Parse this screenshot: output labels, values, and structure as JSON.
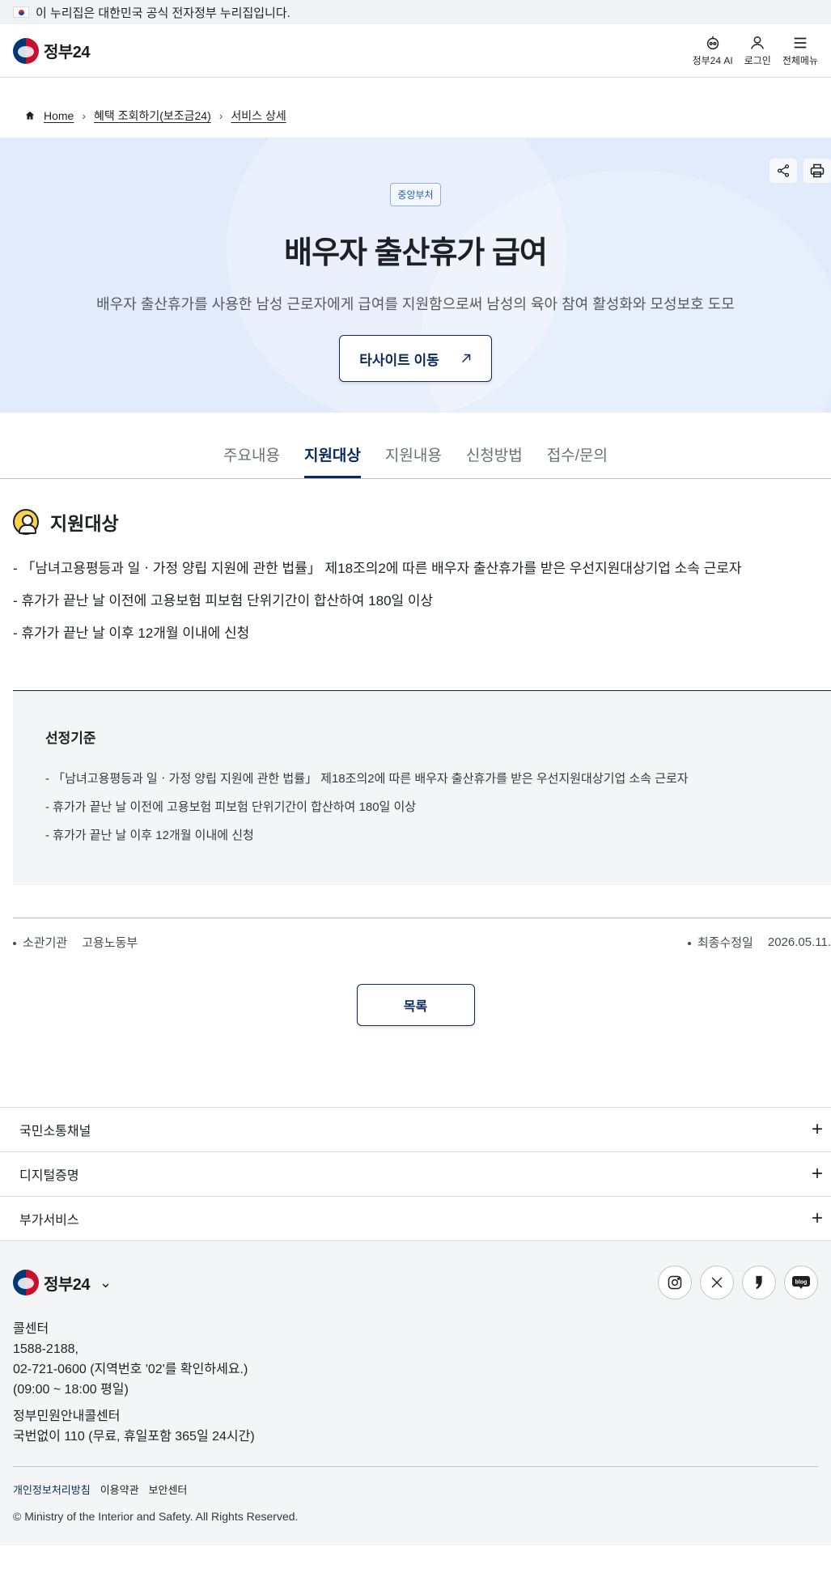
{
  "banner": {
    "text": "이 누리집은 대한민국 공식 전자정부 누리집입니다."
  },
  "header": {
    "logo_text": "정부24",
    "ai_label": "정부24 AI",
    "login_label": "로그인",
    "menu_label": "전체메뉴"
  },
  "breadcrumb": {
    "home": "Home",
    "middle": "혜택 조회하기(보조금24)",
    "current": "서비스 상세"
  },
  "hero": {
    "badge": "중앙부처",
    "title": "배우자 출산휴가 급여",
    "description": "배우자 출산휴가를 사용한 남성 근로자에게 급여를 지원함으로써 남성의 육아 참여 활성화와 모성보호 도모",
    "site_button": "타사이트 이동"
  },
  "tabs": [
    "주요내용",
    "지원대상",
    "지원내용",
    "신청방법",
    "접수/문의"
  ],
  "active_tab": "지원대상",
  "section": {
    "title": "지원대상",
    "items": [
      "- 「남녀고용평등과 일ㆍ가정 양립 지원에 관한 법률」 제18조의2에 따른 배우자 출산휴가를 받은 우선지원대상기업 소속 근로자",
      "- 휴가가 끝난 날 이전에 고용보험 피보험 단위기간이 합산하여 180일 이상",
      "- 휴가가 끝난 날 이후 12개월 이내에 신청"
    ]
  },
  "criteria": {
    "title": "선정기준",
    "items": [
      "- 「남녀고용평등과 일ㆍ가정 양립 지원에 관한 법률」 제18조의2에 따른 배우자 출산휴가를 받은 우선지원대상기업 소속 근로자",
      "- 휴가가 끝난 날 이전에 고용보험 피보험 단위기간이 합산하여 180일 이상",
      "- 휴가가 끝난 날 이후 12개월 이내에 신청"
    ]
  },
  "meta": {
    "agency_label": "소관기관",
    "agency_value": "고용노동부",
    "updated_label": "최종수정일",
    "updated_value": "2026.05.11."
  },
  "list_button": "목록",
  "accordion": [
    "국민소통채널",
    "디지털증명",
    "부가서비스"
  ],
  "footer": {
    "logo_text": "정부24",
    "social": [
      "instagram-icon",
      "x-icon",
      "kakao-icon",
      "blog-icon"
    ],
    "blog_label": "blog",
    "call_center_title": "콜센터",
    "call_center_line1": "1588-2188,",
    "call_center_line2": "02-721-0600 (지역번호 '02'를 확인하세요.)",
    "call_center_hours": "(09:00 ~ 18:00 평일)",
    "petition_title": "정부민원안내콜센터",
    "petition_line": "국번없이 110 (무료, 휴일포함 365일 24시간)",
    "links": [
      "개인정보처리방침",
      "이용약관",
      "보안센터"
    ],
    "copyright": "© Ministry of the Interior and Safety. All Rights Reserved."
  },
  "colors": {
    "navy": "#0b2a5b",
    "hero_bg": "#e2ebfb",
    "accent_red": "#c8102e"
  }
}
